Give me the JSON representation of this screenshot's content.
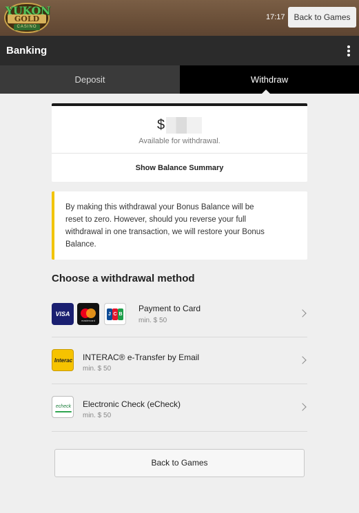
{
  "topbar": {
    "logo": {
      "line1": "YUKON",
      "line2": "GOLD",
      "line3": "CASINO"
    },
    "clock": "17:17",
    "back_label": "Back to Games"
  },
  "header": {
    "title": "Banking",
    "menu_icon": "kebab-menu-icon"
  },
  "tabs": [
    {
      "label": "Deposit",
      "active": false
    },
    {
      "label": "Withdraw",
      "active": true
    }
  ],
  "balance": {
    "currency": "$",
    "amount_hidden": true,
    "available_text": "Available for withdrawal.",
    "summary_link": "Show Balance Summary"
  },
  "notice": {
    "text": "By making this withdrawal your Bonus Balance will be reset to zero. However, should you reverse your full withdrawal in one transaction, we will restore your Bonus Balance.",
    "accent_color": "#f2c400"
  },
  "methods": {
    "heading": "Choose a withdrawal method",
    "items": [
      {
        "name": "Payment to Card",
        "min": "min. $ 50",
        "icons": {
          "visa": "VISA",
          "mastercard": "mastercard",
          "jcb": [
            "J",
            "C",
            "B"
          ]
        }
      },
      {
        "name": "INTERAC® e-Transfer by Email",
        "min": "min. $ 50",
        "icon_text": "Interac"
      },
      {
        "name": "Electronic Check (eCheck)",
        "min": "min. $ 50",
        "icon_text": "echeck"
      }
    ]
  },
  "footer": {
    "back_label": "Back to Games"
  },
  "colors": {
    "header_bg": "#2b2b2b",
    "tab_active_bg": "#000000",
    "page_bg": "#efefef"
  }
}
